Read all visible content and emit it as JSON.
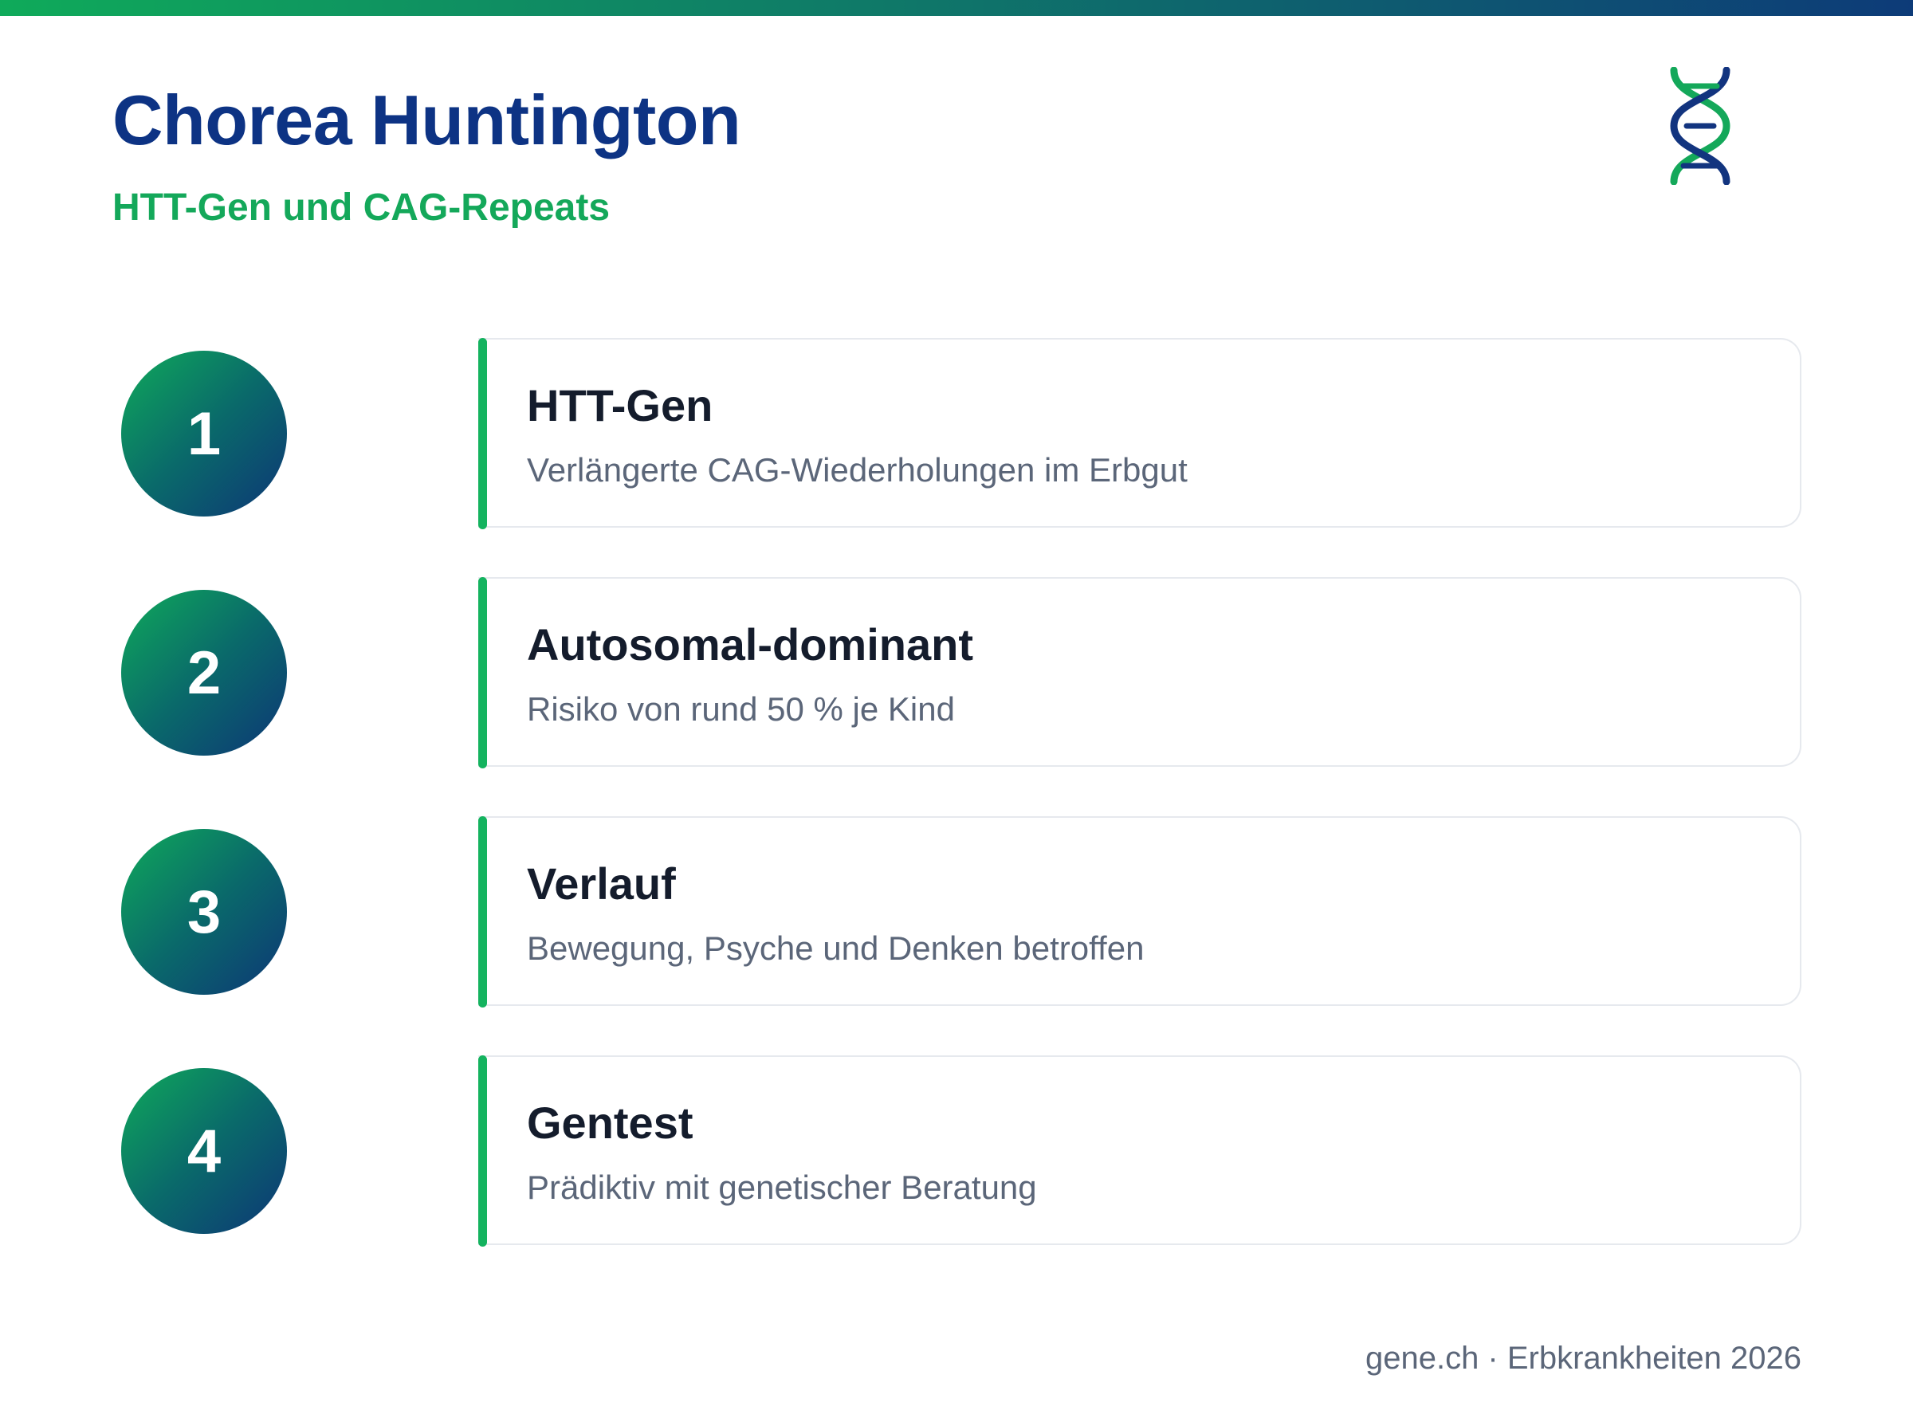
{
  "header": {
    "title": "Chorea Huntington",
    "subtitle": "HTT-Gen und CAG-Repeats",
    "logo_icon": "dna-icon"
  },
  "colors": {
    "title": "#0d3384",
    "accent_green": "#14a85a",
    "navy": "#0d3676",
    "text_dark": "#141c2c",
    "text_muted": "#5b6679"
  },
  "steps": [
    {
      "number": "1",
      "title": "HTT-Gen",
      "description": "Verlängerte CAG-Wiederholungen im Erbgut"
    },
    {
      "number": "2",
      "title": "Autosomal-dominant",
      "description": "Risiko von rund 50 % je Kind"
    },
    {
      "number": "3",
      "title": "Verlauf",
      "description": "Bewegung, Psyche und Denken betroffen"
    },
    {
      "number": "4",
      "title": "Gentest",
      "description": "Prädiktiv mit genetischer Beratung"
    }
  ],
  "footer": {
    "text": "gene.ch · Erbkrankheiten 2026"
  }
}
